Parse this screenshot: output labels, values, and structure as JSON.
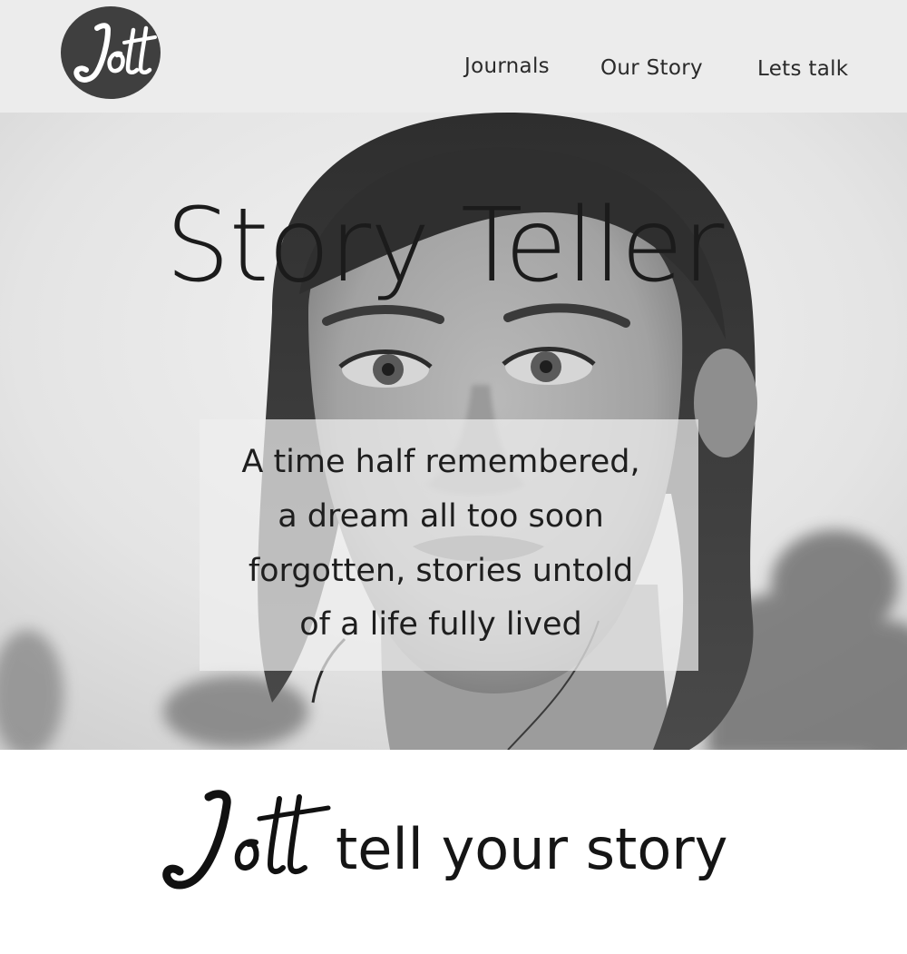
{
  "header": {
    "logo_text": "Jott",
    "nav": [
      {
        "label": "Journals"
      },
      {
        "label": "Our Story"
      },
      {
        "label": "Lets talk"
      }
    ]
  },
  "hero": {
    "title": "Story Teller",
    "quote_lines": [
      "A time half remembered,",
      "a dream all too soon",
      "forgotten, stories untold",
      "of a life fully lived"
    ]
  },
  "footer": {
    "logo_text": "Jott",
    "tagline": "tell your story"
  },
  "colors": {
    "header_bg": "#ececec",
    "logo_badge": "#3f3f3f",
    "text_dark": "#1b1b1b"
  }
}
